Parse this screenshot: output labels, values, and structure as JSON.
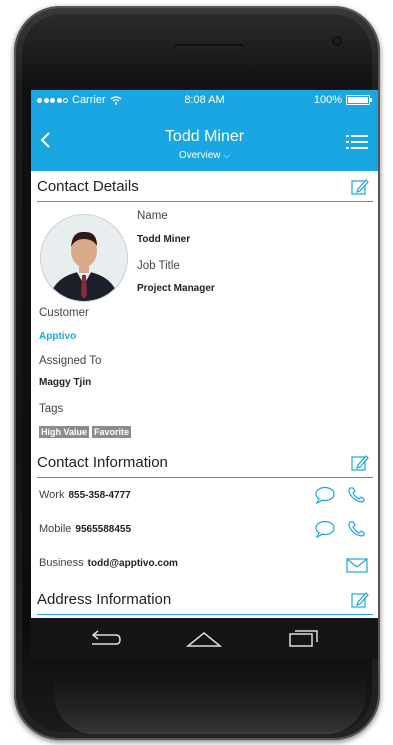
{
  "status": {
    "carrier": "Carrier",
    "time": "8:08 AM",
    "battery": "100%"
  },
  "header": {
    "title": "Todd Miner",
    "subtitle": "Overview"
  },
  "contact_details": {
    "heading": "Contact Details",
    "name_label": "Name",
    "name_value": "Todd Miner",
    "job_label": "Job Title",
    "job_value": "Project Manager",
    "customer_label": "Customer",
    "customer_value": "Apptivo",
    "assigned_label": "Assigned To",
    "assigned_value": "Maggy Tjin",
    "tags_label": "Tags",
    "tags": [
      "High Value",
      "Favorite"
    ]
  },
  "contact_information": {
    "heading": "Contact Information",
    "rows": [
      {
        "label": "Work",
        "value": "855-358-4777"
      },
      {
        "label": "Mobile",
        "value": "9565588455"
      },
      {
        "label": "Business",
        "value": "todd@apptivo.com"
      }
    ]
  },
  "address_information": {
    "heading": "Address Information"
  },
  "colors": {
    "accent": "#1aa6e3",
    "tag": "#8c8c8c"
  }
}
